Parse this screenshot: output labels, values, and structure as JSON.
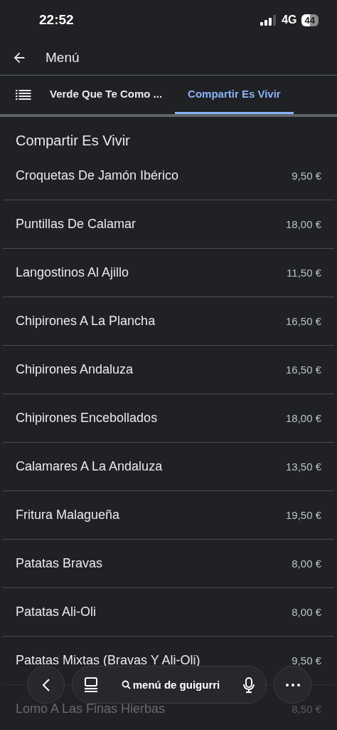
{
  "status_bar": {
    "time": "22:52",
    "network": "4G",
    "battery": "44"
  },
  "toolbar": {
    "title": "Menú"
  },
  "tabs": [
    {
      "label": "Verde Que Te Como ...",
      "selected": false
    },
    {
      "label": "Compartir Es Vivir",
      "selected": true
    }
  ],
  "section": {
    "title": "Compartir Es Vivir"
  },
  "items": [
    {
      "name": "Croquetas De Jamón Ibérico",
      "price": "9,50 €"
    },
    {
      "name": "Puntillas De Calamar",
      "price": "18,00 €"
    },
    {
      "name": "Langostinos Al Ajillo",
      "price": "11,50 €"
    },
    {
      "name": "Chipirones A La Plancha",
      "price": "16,50 €"
    },
    {
      "name": "Chipirones Andaluza",
      "price": "16,50 €"
    },
    {
      "name": "Chipirones Encebollados",
      "price": "18,00 €"
    },
    {
      "name": "Calamares A La Andaluza",
      "price": "13,50 €"
    },
    {
      "name": "Fritura Malagueña",
      "price": "19,50 €"
    },
    {
      "name": "Patatas Bravas",
      "price": "8,00 €"
    },
    {
      "name": "Patatas Ali-Oli",
      "price": "8,00 €"
    },
    {
      "name": "Patatas Mixtas (Bravas Y Ali-Oli)",
      "price": "9,50 €"
    },
    {
      "name": "Lomo A Las Finas Hierbas",
      "price": "8,50 €"
    }
  ],
  "bottom_bar": {
    "search": "menú de guigurri"
  }
}
